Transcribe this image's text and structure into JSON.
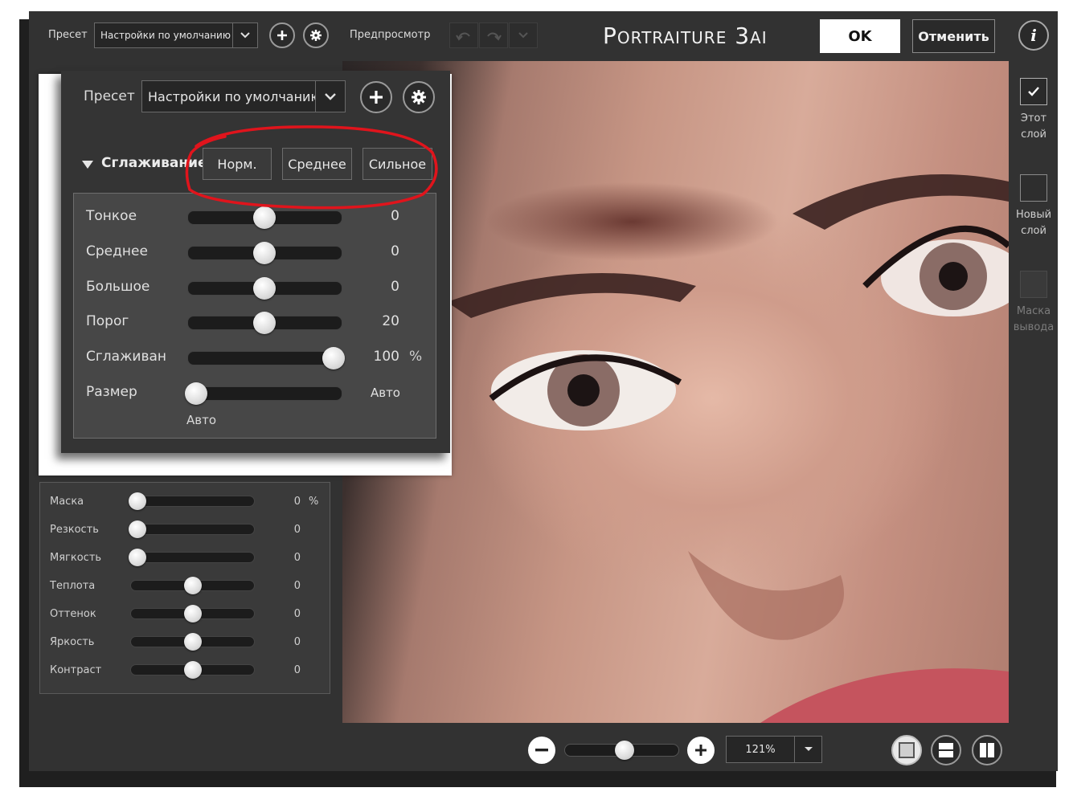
{
  "top_bar": {
    "preset_label": "Пресет",
    "preset_value": "Настройки по умолчанию",
    "preview_label": "Предпросмотр",
    "app_title": "Portraiture 3ai",
    "ok_label": "OK",
    "cancel_label": "Отменить"
  },
  "popup": {
    "preset_label": "Пресет",
    "preset_value": "Настройки по умолчанию",
    "section_title": "Сглаживание",
    "presets": [
      "Норм.",
      "Среднее",
      "Сильное"
    ],
    "sliders": [
      {
        "label": "Тонкое",
        "value": "0",
        "unit": "",
        "level": 0.5
      },
      {
        "label": "Среднее",
        "value": "0",
        "unit": "",
        "level": 0.5
      },
      {
        "label": "Большое",
        "value": "0",
        "unit": "",
        "level": 0.5
      },
      {
        "label": "Порог",
        "value": "20",
        "unit": "",
        "level": 0.5
      },
      {
        "label": "Сглаживан",
        "value": "100",
        "unit": "%",
        "level": 0.94
      },
      {
        "label": "Размер",
        "value": "Авто",
        "unit": "",
        "level": 0.0
      }
    ],
    "size_sub_label": "Авто",
    "highlight_color": "#e0141c"
  },
  "enhance_panel": {
    "sliders": [
      {
        "label": "Маска",
        "value": "0",
        "unit": "%",
        "level": 0.0
      },
      {
        "label": "Резкость",
        "value": "0",
        "unit": "",
        "level": 0.0
      },
      {
        "label": "Мягкость",
        "value": "0",
        "unit": "",
        "level": 0.0
      },
      {
        "label": "Теплота",
        "value": "0",
        "unit": "",
        "level": 0.5
      },
      {
        "label": "Оттенок",
        "value": "0",
        "unit": "",
        "level": 0.5
      },
      {
        "label": "Яркость",
        "value": "0",
        "unit": "",
        "level": 0.5
      },
      {
        "label": "Контраст",
        "value": "0",
        "unit": "",
        "level": 0.5
      }
    ]
  },
  "right_sidebar": {
    "this_layer": "Этот слой",
    "new_layer": "Новый слой",
    "output_mask": "Маска вывода"
  },
  "bottom_bar": {
    "zoom_value": "121%",
    "zoom_level": 0.5
  },
  "icons": [
    "chevron-down-icon",
    "plus-icon",
    "gear-icon",
    "undo-icon",
    "redo-icon",
    "info-icon",
    "check-icon",
    "minus-icon",
    "single-view-icon",
    "split-horizontal-icon",
    "split-vertical-icon"
  ]
}
